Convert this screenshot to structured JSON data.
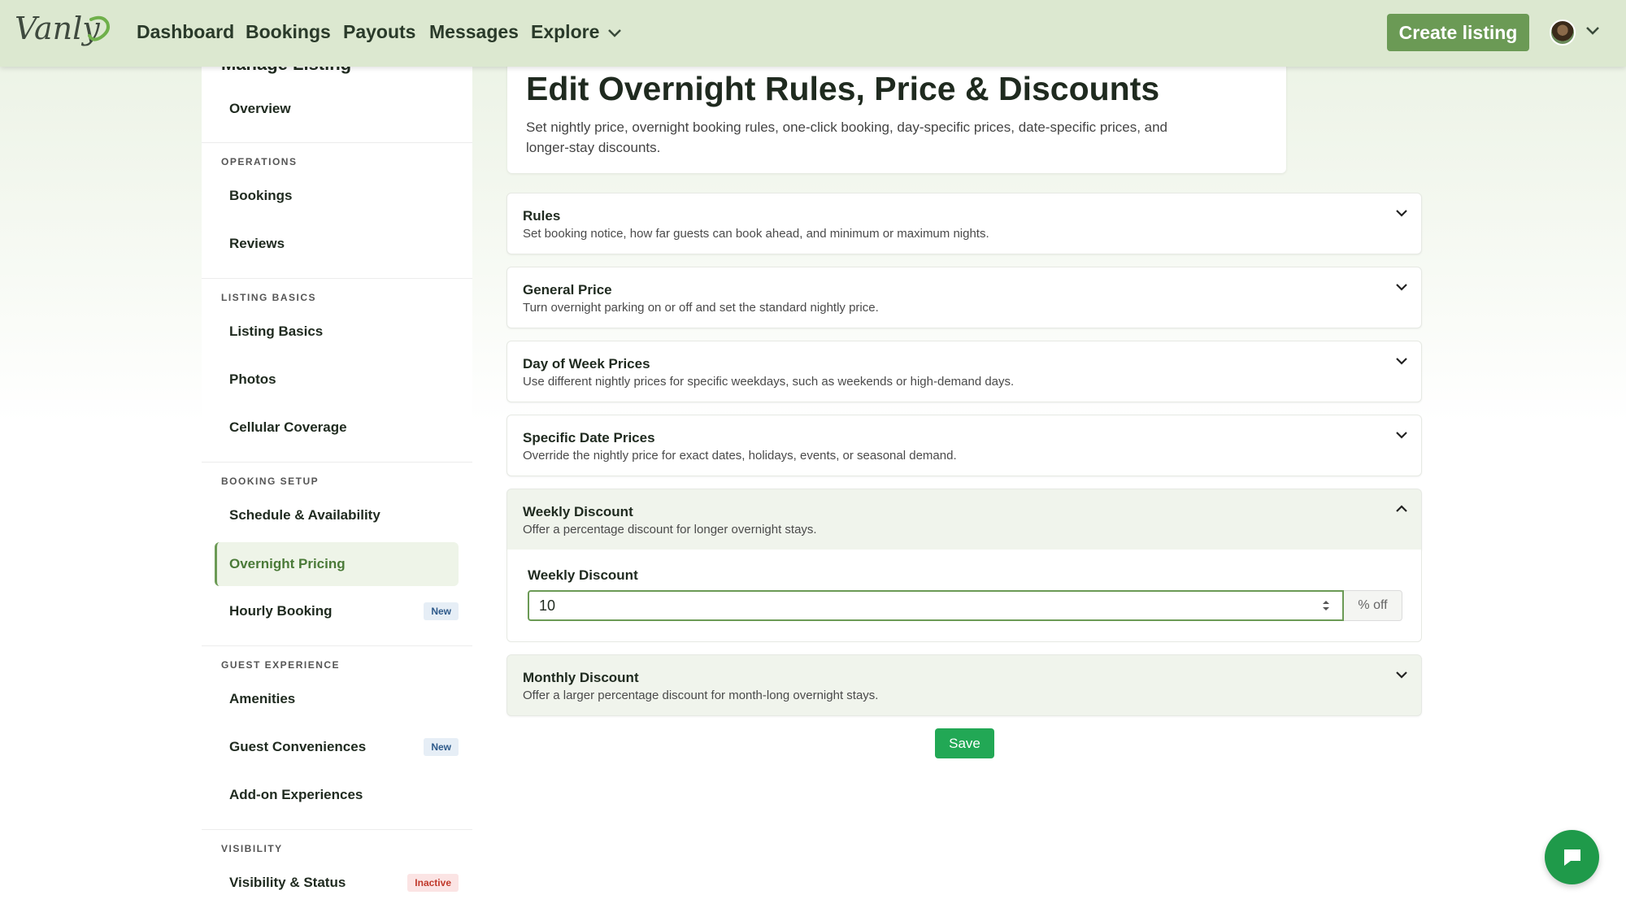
{
  "nav": {
    "logo_text": "Vanly",
    "links": [
      "Dashboard",
      "Bookings",
      "Payouts",
      "Messages",
      "Explore"
    ],
    "create_label": "Create listing"
  },
  "sidebar": {
    "heading": "Manage Listing",
    "overview": "Overview",
    "sections": [
      "OPERATIONS",
      "LISTING BASICS",
      "BOOKING SETUP",
      "GUEST EXPERIENCE",
      "VISIBILITY"
    ],
    "items": {
      "bookings": "Bookings",
      "reviews": "Reviews",
      "listing_basics": "Listing Basics",
      "photos": "Photos",
      "cellular": "Cellular Coverage",
      "schedule": "Schedule & Availability",
      "overnight": "Overnight Pricing",
      "hourly": "Hourly Booking",
      "amenities": "Amenities",
      "conveniences": "Guest Conveniences",
      "addons": "Add-on Experiences",
      "visibility": "Visibility & Status"
    },
    "badges": {
      "new": "New",
      "inactive": "Inactive"
    }
  },
  "header": {
    "title": "Edit Overnight Rules, Price & Discounts",
    "subtitle": "Set nightly price, overnight booking rules, one-click booking, day-specific prices, date-specific prices, and longer-stay discounts."
  },
  "accordions": [
    {
      "title": "Rules",
      "desc": "Set booking notice, how far guests can book ahead, and minimum or maximum nights."
    },
    {
      "title": "General Price",
      "desc": "Turn overnight parking on or off and set the standard nightly price."
    },
    {
      "title": "Day of Week Prices",
      "desc": "Use different nightly prices for specific weekdays, such as weekends or high-demand days."
    },
    {
      "title": "Specific Date Prices",
      "desc": "Override the nightly price for exact dates, holidays, events, or seasonal demand."
    },
    {
      "title": "Weekly Discount",
      "desc": "Offer a percentage discount for longer overnight stays."
    },
    {
      "title": "Monthly Discount",
      "desc": "Offer a larger percentage discount for month-long overnight stays."
    }
  ],
  "weekly": {
    "label": "Weekly Discount",
    "value": "10",
    "suffix": "% off"
  },
  "save_label": "Save"
}
